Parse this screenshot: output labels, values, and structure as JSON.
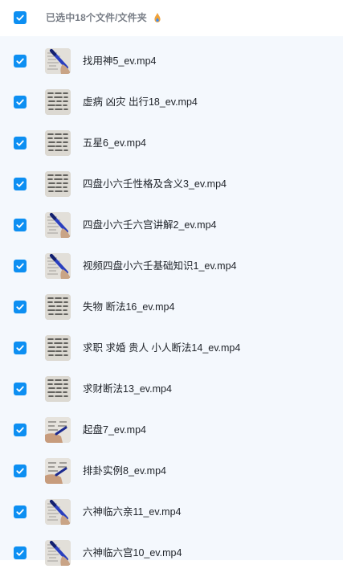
{
  "header": {
    "selection_label": "已选中18个文件/文件夹",
    "select_all_checked": true
  },
  "colors": {
    "accent": "#0d8ff2",
    "list_background": "#f4f8fd",
    "text": "#1f2329",
    "muted_text": "#7b8089"
  },
  "files": [
    {
      "name": "找用神5_ev.mp4",
      "checked": true,
      "thumbnail": "video-thumbnail-pen-on-paper"
    },
    {
      "name": "虚病 凶灾 出行18_ev.mp4",
      "checked": true,
      "thumbnail": "video-thumbnail-handwritten-sheet"
    },
    {
      "name": "五星6_ev.mp4",
      "checked": true,
      "thumbnail": "video-thumbnail-handwritten-sheet"
    },
    {
      "name": "四盘小六壬性格及含义3_ev.mp4",
      "checked": true,
      "thumbnail": "video-thumbnail-handwritten-sheet"
    },
    {
      "name": "四盘小六壬六宫讲解2_ev.mp4",
      "checked": true,
      "thumbnail": "video-thumbnail-pen-on-paper"
    },
    {
      "name": "视频四盘小六壬基础知识1_ev.mp4",
      "checked": true,
      "thumbnail": "video-thumbnail-pen-on-paper"
    },
    {
      "name": "失物 断法16_ev.mp4",
      "checked": true,
      "thumbnail": "video-thumbnail-handwritten-sheet"
    },
    {
      "name": "求职 求婚 贵人 小人断法14_ev.mp4",
      "checked": true,
      "thumbnail": "video-thumbnail-handwritten-sheet"
    },
    {
      "name": "求财断法13_ev.mp4",
      "checked": true,
      "thumbnail": "video-thumbnail-handwritten-sheet"
    },
    {
      "name": "起盘7_ev.mp4",
      "checked": true,
      "thumbnail": "video-thumbnail-hand-on-paper"
    },
    {
      "name": "排卦实例8_ev.mp4",
      "checked": true,
      "thumbnail": "video-thumbnail-hand-on-paper"
    },
    {
      "name": "六神临六亲11_ev.mp4",
      "checked": true,
      "thumbnail": "video-thumbnail-pen-on-paper"
    },
    {
      "name": "六神临六宫10_ev.mp4",
      "checked": true,
      "thumbnail": "video-thumbnail-pen-on-paper"
    }
  ]
}
